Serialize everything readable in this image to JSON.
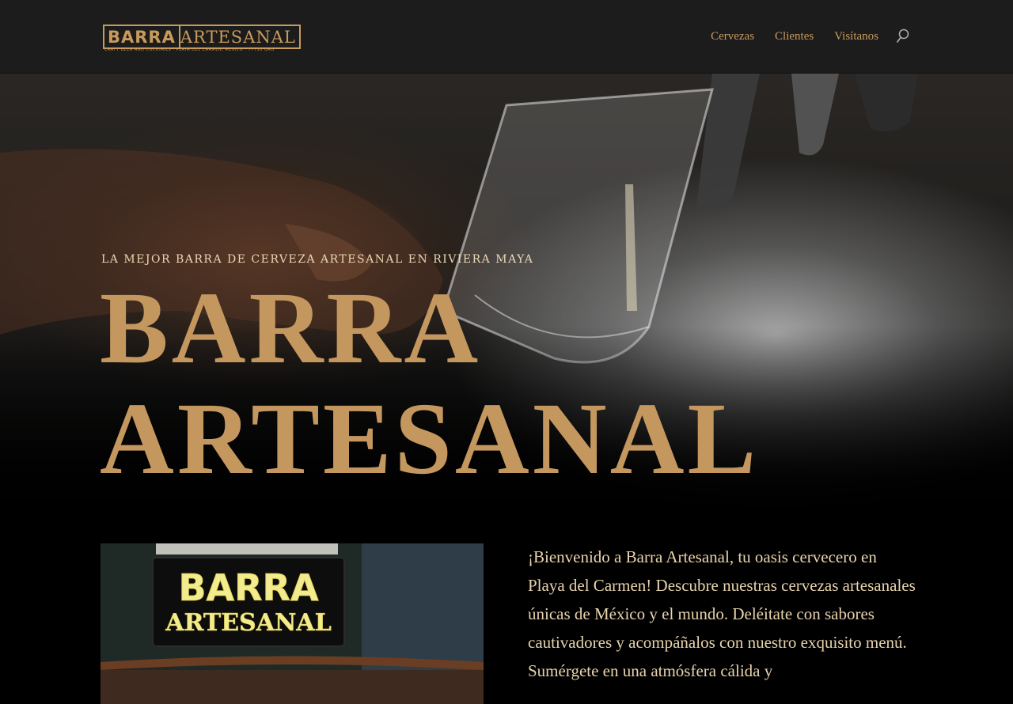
{
  "header": {
    "logo": {
      "word1": "BARRA",
      "word2": "ARTESANAL",
      "tagline": "CRAFT BEER AND COCKTAILS · PLAYA DEL CARMEN, MEXICO · 77710 QRO"
    },
    "nav": [
      {
        "label": "Cervezas"
      },
      {
        "label": "Clientes"
      },
      {
        "label": "Visítanos"
      }
    ],
    "search_icon": "search-icon"
  },
  "hero": {
    "subtitle": "LA MEJOR BARRA DE CERVEZA ARTESANAL EN RIVIERA MAYA",
    "title_line1": "BARRA",
    "title_line2": "ARTESANAL"
  },
  "photo": {
    "sign_line1": "BARRA",
    "sign_line2": "ARTESANAL"
  },
  "intro": {
    "text": "¡Bienvenido a Barra Artesanal, tu oasis cervecero en Playa del Carmen! Descubre nuestras cervezas artesanales únicas de México y el mundo. Deléitate con sabores cautivadores y acompáñalos con nuestro exquisito menú. Sumérgete en una atmósfera cálida y"
  },
  "colors": {
    "accent": "#c4975f",
    "header_bg": "#1c1c1c",
    "text_light": "#e8d3ad"
  }
}
